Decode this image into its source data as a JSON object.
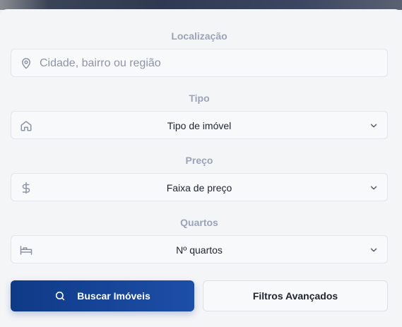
{
  "form": {
    "location": {
      "label": "Localização",
      "placeholder": "Cidade, bairro ou região",
      "icon": "map-pin-icon"
    },
    "type": {
      "label": "Tipo",
      "value": "Tipo de imóvel",
      "icon": "home-icon"
    },
    "price": {
      "label": "Preço",
      "value": "Faixa de preço",
      "icon": "dollar-icon"
    },
    "rooms": {
      "label": "Quartos",
      "value": "Nº quartos",
      "icon": "bed-icon"
    }
  },
  "actions": {
    "search_label": "Buscar Imóveis",
    "advanced_label": "Filtros Avançados"
  },
  "colors": {
    "primary": "#1d4ea8",
    "label": "#9aa4b8",
    "text": "#1e2430"
  }
}
